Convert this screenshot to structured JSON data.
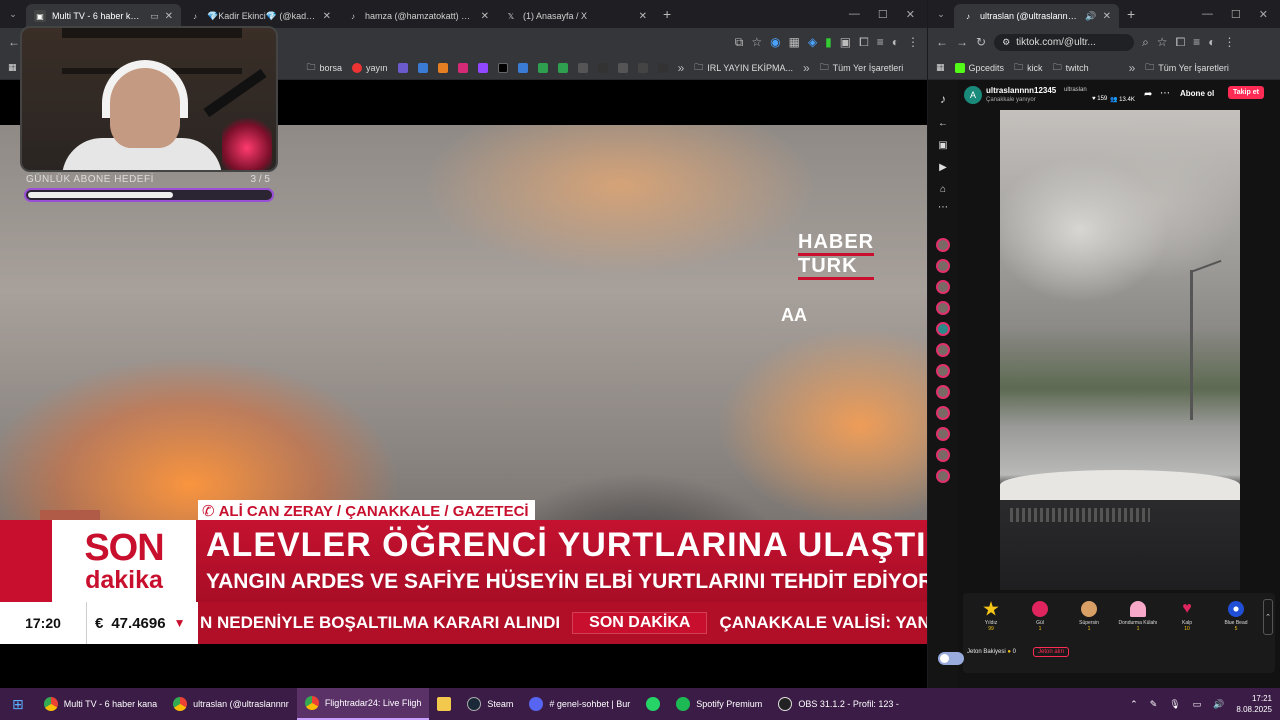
{
  "left_window": {
    "tabs": [
      {
        "label": "Multi TV - 6 haber kanalını",
        "active": true
      },
      {
        "label": "💎Kadir Ekinci💎 (@kadirekinci",
        "active": false
      },
      {
        "label": "hamza (@hamzatokatt) CANLI",
        "active": false
      },
      {
        "label": "(1) Anasayfa / X",
        "active": false
      }
    ],
    "bookmarks": [
      "borsa",
      "yayın",
      "IRL YAYIN EKİPMA...",
      "Tüm Yer İşaretleri"
    ]
  },
  "stream": {
    "goal_label": "GÜNLÜK ABONE HEDEFİ",
    "goal_count": "3 / 5",
    "goal_progress": 0.6
  },
  "news": {
    "channel_logo_1": "HABER",
    "channel_logo_2": "TURK",
    "agency_logo": "AA",
    "reporter": "ALİ CAN ZERAY / ÇANAKKALE / GAZETECİ",
    "son": "SON",
    "dakika": "dakika",
    "headline": "ALEVLER ÖĞRENCİ YURTLARINA ULAŞTI",
    "subheadline": "YANGIN ARDES VE SAFİYE HÜSEYİN ELBİ YURTLARINI TEHDİT EDİYOR",
    "clock": "17:20",
    "euro_symbol": "€",
    "euro_rate": "47.4696",
    "ticker_1": "N NEDENİYLE BOŞALTILMA KARARI ALINDI",
    "ticker_pill": "SON DAKİKA",
    "ticker_2": "ÇANAKKALE VALİSİ: YAN"
  },
  "right_window": {
    "tab": "ultraslan (@ultraslannnn12",
    "url": "tiktok.com/@ultr...",
    "bookmarks": [
      "Gpcedits",
      "kick",
      "twitch",
      "Tüm Yer İşaretleri"
    ],
    "username": "ultraslannnn12345",
    "handle": "ultraslan",
    "sub": "Çanakkale yanıyor",
    "likes": "159",
    "viewers": "13.4K",
    "subscribe": "Abone ol",
    "follow": "Takip et",
    "gifts": [
      {
        "name": "Yıldız",
        "price": "99"
      },
      {
        "name": "Gül",
        "price": "1"
      },
      {
        "name": "Süpersin",
        "price": "1"
      },
      {
        "name": "Dondurma Külahı",
        "price": "1"
      },
      {
        "name": "Kalp",
        "price": "10"
      },
      {
        "name": "Blue Bead",
        "price": "5"
      }
    ],
    "balance_label": "Jeton Bakiyesi",
    "balance": "0",
    "recharge": "Jeton alın"
  },
  "taskbar": {
    "items": [
      "Multi TV - 6 haber kana",
      "ultraslan (@ultraslannnr",
      "Flightradar24: Live Fligh",
      "Steam",
      "# genel-sohbet | Bur",
      "Spotify Premium",
      "OBS 31.1.2 - Profil: 123 -"
    ],
    "time": "17:21",
    "date": "8.08.2025"
  },
  "colors": {
    "brand_red": "#c8102e",
    "taskbar": "#3b1c47",
    "goal_border": "#9a4fd6"
  }
}
